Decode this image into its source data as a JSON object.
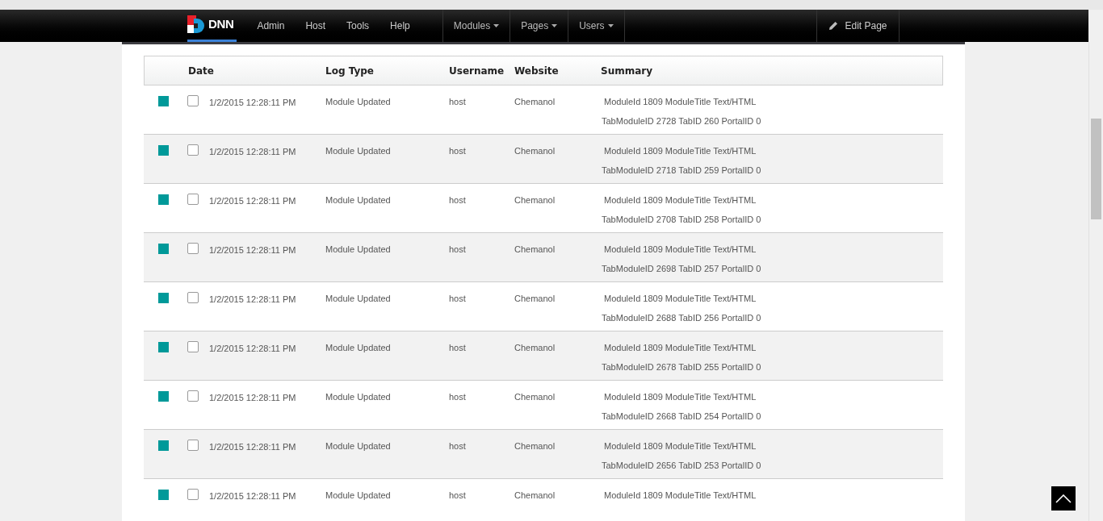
{
  "topbar": {
    "logo": "DNN",
    "menu": [
      {
        "label": "Admin"
      },
      {
        "label": "Host"
      },
      {
        "label": "Tools"
      },
      {
        "label": "Help"
      }
    ],
    "dropdowns": [
      {
        "label": "Modules"
      },
      {
        "label": "Pages"
      },
      {
        "label": "Users"
      }
    ],
    "edit_button": "Edit Page"
  },
  "table": {
    "columns": [
      "Date",
      "Log Type",
      "Username",
      "Website",
      "Summary"
    ],
    "rows": [
      {
        "color": "#009999",
        "checked": false,
        "date": "1/2/2015 12:28:11 PM",
        "log_type": "Module Updated",
        "username": "host",
        "website": "Chemanol",
        "summary": [
          "ModuleId 1809 ModuleTitle Text/HTML",
          "TabModuleID 2728 TabID 260 PortalID 0"
        ]
      },
      {
        "color": "#009999",
        "checked": false,
        "date": "1/2/2015 12:28:11 PM",
        "log_type": "Module Updated",
        "username": "host",
        "website": "Chemanol",
        "summary": [
          "ModuleId 1809 ModuleTitle Text/HTML",
          "TabModuleID 2718 TabID 259 PortalID 0"
        ]
      },
      {
        "color": "#009999",
        "checked": false,
        "date": "1/2/2015 12:28:11 PM",
        "log_type": "Module Updated",
        "username": "host",
        "website": "Chemanol",
        "summary": [
          "ModuleId 1809 ModuleTitle Text/HTML",
          "TabModuleID 2708 TabID 258 PortalID 0"
        ]
      },
      {
        "color": "#009999",
        "checked": false,
        "date": "1/2/2015 12:28:11 PM",
        "log_type": "Module Updated",
        "username": "host",
        "website": "Chemanol",
        "summary": [
          "ModuleId 1809 ModuleTitle Text/HTML",
          "TabModuleID 2698 TabID 257 PortalID 0"
        ]
      },
      {
        "color": "#009999",
        "checked": false,
        "date": "1/2/2015 12:28:11 PM",
        "log_type": "Module Updated",
        "username": "host",
        "website": "Chemanol",
        "summary": [
          "ModuleId 1809 ModuleTitle Text/HTML",
          "TabModuleID 2688 TabID 256 PortalID 0"
        ]
      },
      {
        "color": "#009999",
        "checked": false,
        "date": "1/2/2015 12:28:11 PM",
        "log_type": "Module Updated",
        "username": "host",
        "website": "Chemanol",
        "summary": [
          "ModuleId 1809 ModuleTitle Text/HTML",
          "TabModuleID 2678 TabID 255 PortalID 0"
        ]
      },
      {
        "color": "#009999",
        "checked": false,
        "date": "1/2/2015 12:28:11 PM",
        "log_type": "Module Updated",
        "username": "host",
        "website": "Chemanol",
        "summary": [
          "ModuleId 1809 ModuleTitle Text/HTML",
          "TabModuleID 2668 TabID 254 PortalID 0"
        ]
      },
      {
        "color": "#009999",
        "checked": false,
        "date": "1/2/2015 12:28:11 PM",
        "log_type": "Module Updated",
        "username": "host",
        "website": "Chemanol",
        "summary": [
          "ModuleId 1809 ModuleTitle Text/HTML",
          "TabModuleID 2656 TabID 253 PortalID 0"
        ]
      },
      {
        "color": "#009999",
        "checked": false,
        "date": "1/2/2015 12:28:11 PM",
        "log_type": "Module Updated",
        "username": "host",
        "website": "Chemanol",
        "summary": [
          "ModuleId 1809 ModuleTitle Text/HTML"
        ]
      }
    ]
  }
}
